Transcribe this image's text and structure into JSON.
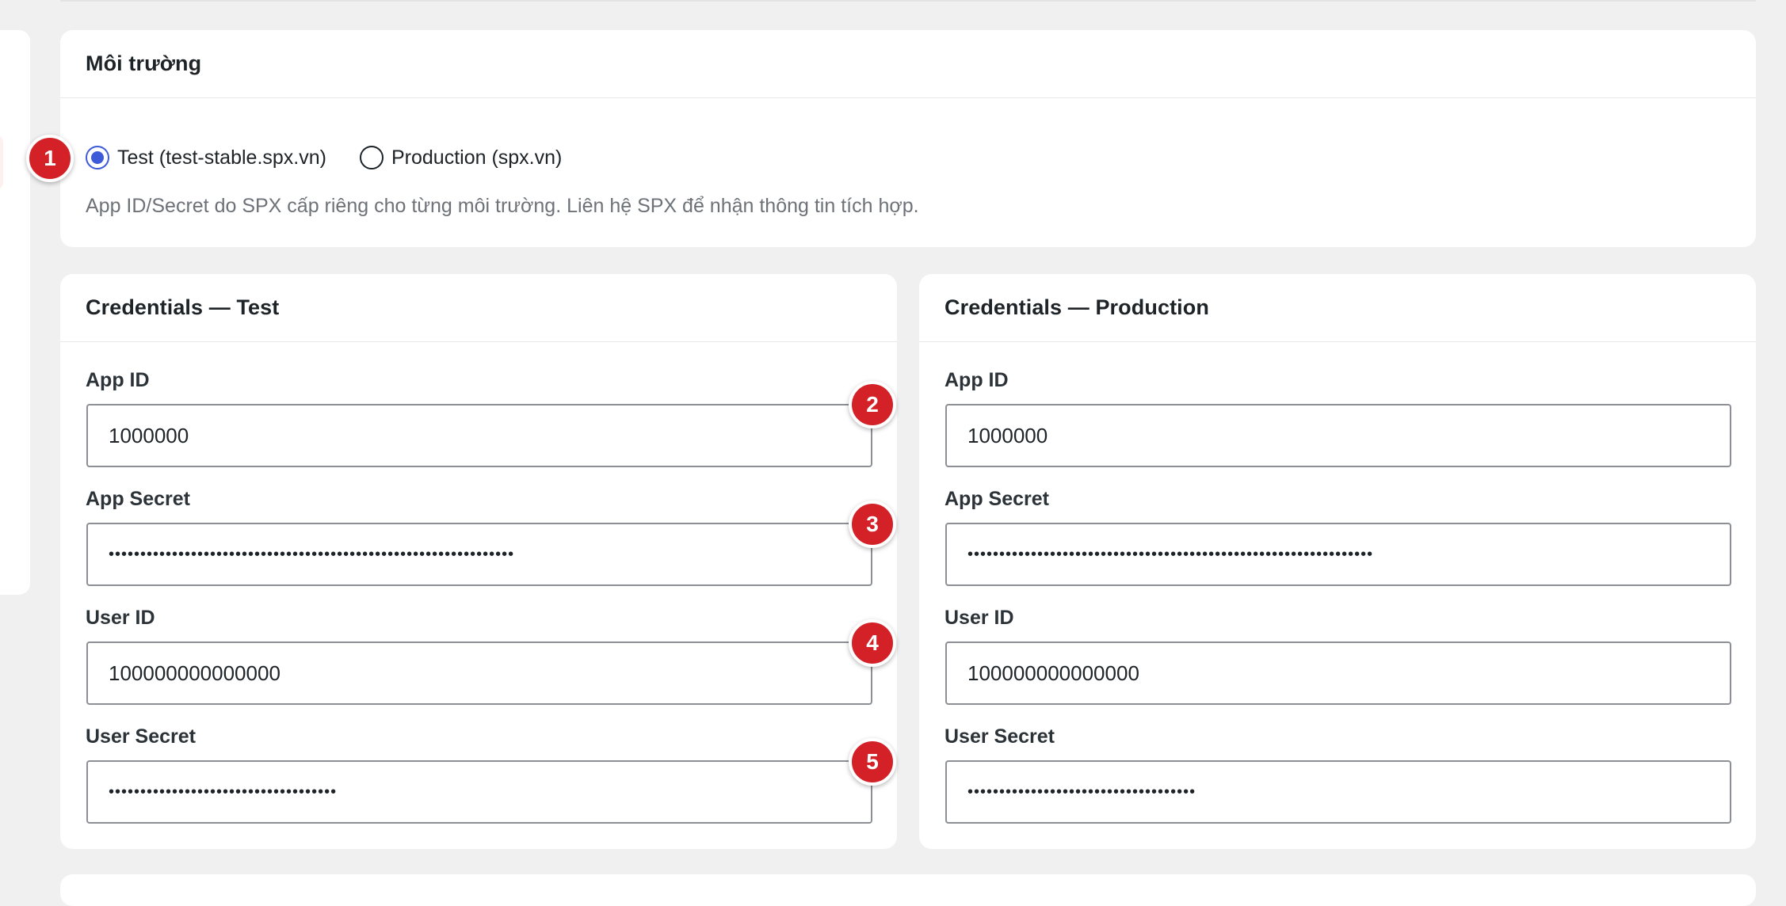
{
  "environment": {
    "title": "Môi trường",
    "options": [
      {
        "label": "Test (test-stable.spx.vn)",
        "checked": true
      },
      {
        "label": "Production (spx.vn)",
        "checked": false
      }
    ],
    "helper": "App ID/Secret do SPX cấp riêng cho từng môi trường. Liên hệ SPX để nhận thông tin tích hợp."
  },
  "credentials_test": {
    "title": "Credentials — Test",
    "app_id_label": "App ID",
    "app_id": "1000000",
    "app_secret_label": "App Secret",
    "app_secret": "••••••••••••••••••••••••••••••••••••••••••••••••••••••••••••••••",
    "user_id_label": "User ID",
    "user_id": "100000000000000",
    "user_secret_label": "User Secret",
    "user_secret": "••••••••••••••••••••••••••••••••••••"
  },
  "credentials_prod": {
    "title": "Credentials — Production",
    "app_id_label": "App ID",
    "app_id": "1000000",
    "app_secret_label": "App Secret",
    "app_secret": "••••••••••••••••••••••••••••••••••••••••••••••••••••••••••••••••",
    "user_id_label": "User ID",
    "user_id": "100000000000000",
    "user_secret_label": "User Secret",
    "user_secret": "••••••••••••••••••••••••••••••••••••"
  },
  "badges": [
    "1",
    "2",
    "3",
    "4",
    "5"
  ],
  "colors": {
    "accent": "#3d5bd9",
    "badge": "#d32127",
    "background": "#f0f0f1"
  }
}
